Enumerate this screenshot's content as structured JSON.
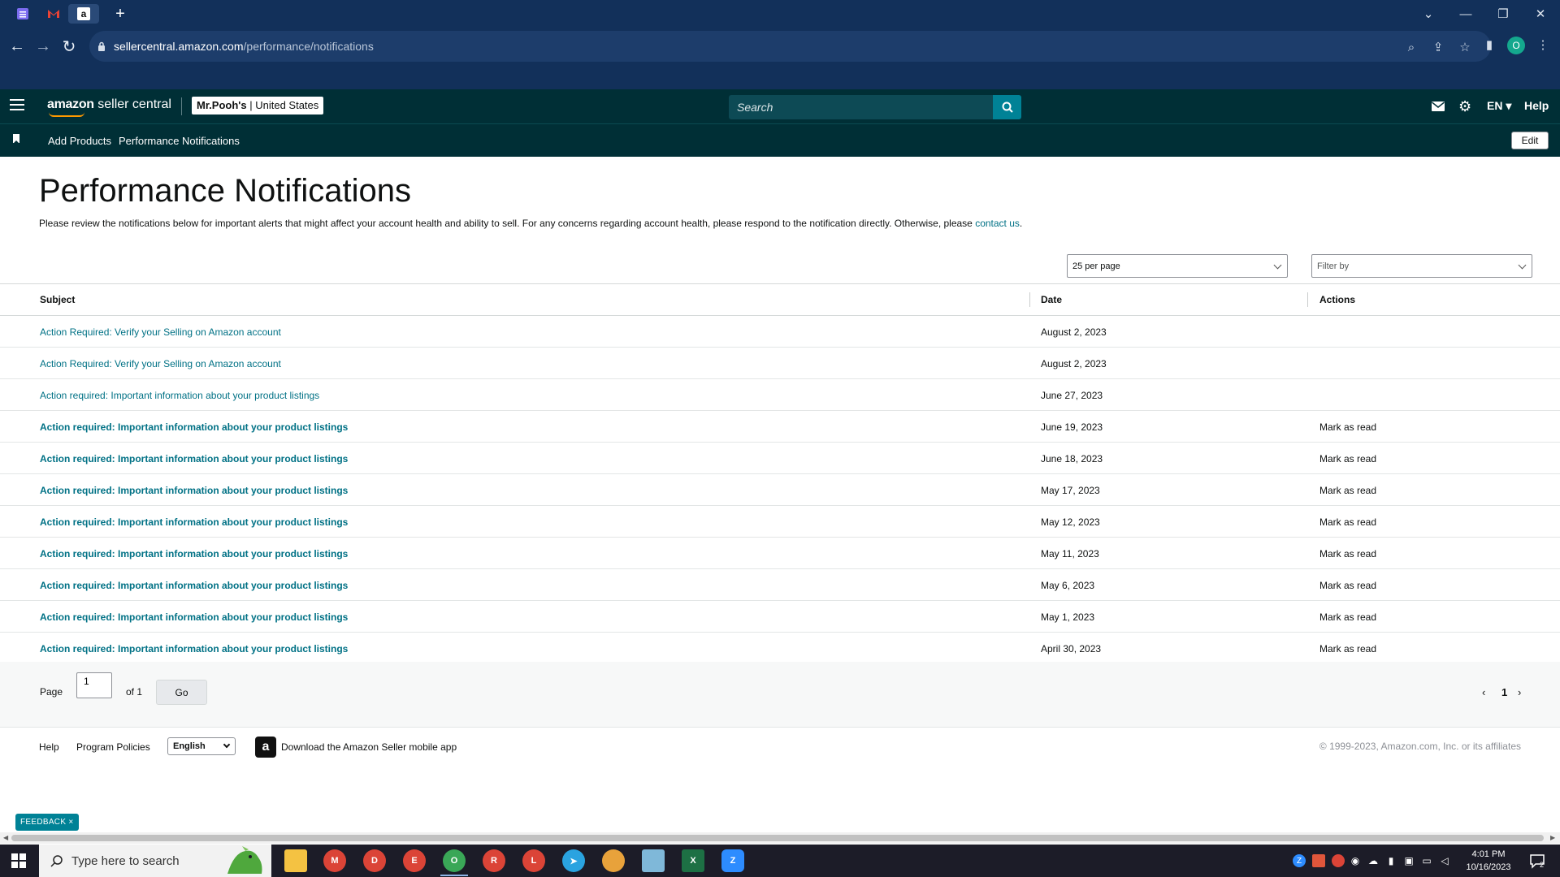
{
  "browser": {
    "url_host": "sellercentral.amazon.com",
    "url_path": "/performance/notifications",
    "profile_initial": "O"
  },
  "header": {
    "logo_brand": "amazon",
    "logo_product": "seller central",
    "store_name": "Mr.Pooh's",
    "store_region": "| United States",
    "search_placeholder": "Search",
    "language": "EN",
    "help": "Help"
  },
  "subnav": {
    "items": [
      "Add Products",
      "Performance Notifications"
    ],
    "edit": "Edit"
  },
  "page": {
    "title": "Performance Notifications",
    "intro": "Please review the notifications below for important alerts that might affect your account health and ability to sell. For any concerns regarding account health, please respond to the notification directly. Otherwise, please ",
    "intro_link": "contact us",
    "intro_end": "."
  },
  "controls": {
    "per_page": "25 per page",
    "filter_placeholder": "Filter by"
  },
  "table": {
    "headers": {
      "subject": "Subject",
      "date": "Date",
      "actions": "Actions"
    },
    "rows": [
      {
        "subject": "Action Required: Verify your Selling on Amazon account",
        "date": "August 2, 2023",
        "action": "",
        "unread": false
      },
      {
        "subject": "Action Required: Verify your Selling on Amazon account",
        "date": "August 2, 2023",
        "action": "",
        "unread": false
      },
      {
        "subject": "Action required: Important information about your product listings",
        "date": "June 27, 2023",
        "action": "",
        "unread": false
      },
      {
        "subject": "Action required: Important information about your product listings",
        "date": "June 19, 2023",
        "action": "Mark as read",
        "unread": true
      },
      {
        "subject": "Action required: Important information about your product listings",
        "date": "June 18, 2023",
        "action": "Mark as read",
        "unread": true
      },
      {
        "subject": "Action required: Important information about your product listings",
        "date": "May 17, 2023",
        "action": "Mark as read",
        "unread": true
      },
      {
        "subject": "Action required: Important information about your product listings",
        "date": "May 12, 2023",
        "action": "Mark as read",
        "unread": true
      },
      {
        "subject": "Action required: Important information about your product listings",
        "date": "May 11, 2023",
        "action": "Mark as read",
        "unread": true
      },
      {
        "subject": "Action required: Important information about your product listings",
        "date": "May 6, 2023",
        "action": "Mark as read",
        "unread": true
      },
      {
        "subject": "Action required: Important information about your product listings",
        "date": "May 1, 2023",
        "action": "Mark as read",
        "unread": true
      },
      {
        "subject": "Action required: Important information about your product listings",
        "date": "April 30, 2023",
        "action": "Mark as read",
        "unread": true
      }
    ]
  },
  "pager": {
    "page_label": "Page",
    "page_value": "1",
    "of_label": "of 1",
    "go": "Go",
    "current": "1"
  },
  "footer": {
    "help": "Help",
    "program_policies": "Program Policies",
    "language": "English",
    "app_text": "Download the Amazon Seller mobile app",
    "copyright": "© 1999-2023, Amazon.com, Inc. or its affiliates"
  },
  "feedback": "FEEDBACK ×",
  "taskbar": {
    "search_placeholder": "Type here to search",
    "time": "4:01 PM",
    "date": "10/16/2023"
  },
  "colors": {
    "header_bg": "#002f36",
    "link": "#007185",
    "accent": "#008296",
    "browser_bg": "#12305a"
  }
}
